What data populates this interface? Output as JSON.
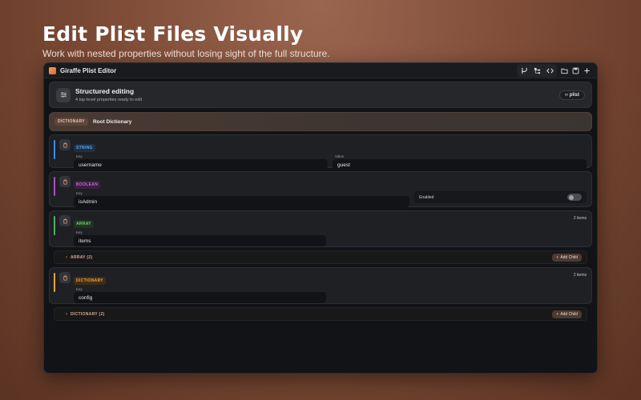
{
  "hero": {
    "title": "Edit Plist Files Visually",
    "subtitle": "Work with nested properties without losing sight of the full structure."
  },
  "window": {
    "title": "Giraffe Plist Editor",
    "toolbar_icons": [
      "branch-icon",
      "tree-icon",
      "code-icon",
      "folder-icon",
      "save-icon",
      "plus-icon"
    ]
  },
  "header": {
    "title": "Structured editing",
    "subtitle": "4 top-level properties ready to edit",
    "plist_button": "‹› plist"
  },
  "root": {
    "badge": "DICTIONARY",
    "label": "Root Dictionary"
  },
  "nodes": [
    {
      "type_badge": "STRING",
      "key_label": "Key",
      "key": "username",
      "value_label": "Value",
      "value": "guest",
      "accent": "#3a8ee6"
    },
    {
      "type_badge": "BOOLEAN",
      "key_label": "Key",
      "key": "isAdmin",
      "toggle_label": "Enabled",
      "enabled": false,
      "accent": "#b04cc8"
    },
    {
      "type_badge": "ARRAY",
      "key_label": "Key",
      "key": "items",
      "count": "2 items",
      "child_label": "ARRAY (2)",
      "add_child": "Add Child",
      "accent": "#4faf5a"
    },
    {
      "type_badge": "DICTIONARY",
      "key_label": "Key",
      "key": "config",
      "count": "2 items",
      "child_label": "DICTIONARY (2)",
      "add_child": "Add Child",
      "accent": "#f0a23c"
    }
  ]
}
